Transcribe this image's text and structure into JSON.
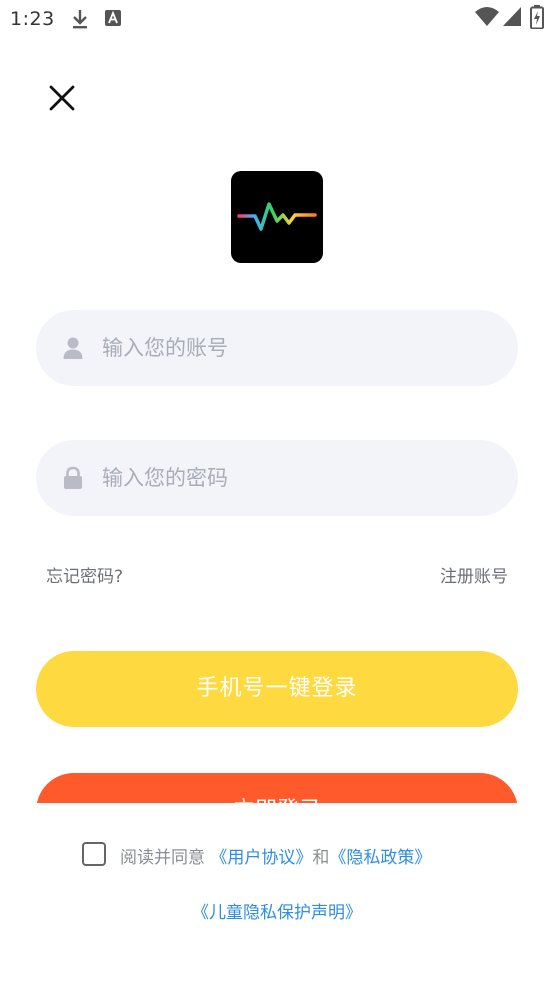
{
  "status_bar": {
    "time": "1:23",
    "icons": [
      "download-icon",
      "text-icon",
      "wifi-icon",
      "signal-icon",
      "battery-charging-icon"
    ]
  },
  "header": {
    "close_icon": "close-icon"
  },
  "logo": {
    "icon": "waveform-icon"
  },
  "form": {
    "account": {
      "placeholder": "输入您的账号",
      "value": "",
      "icon": "user-icon"
    },
    "password": {
      "placeholder": "输入您的密码",
      "value": "",
      "icon": "lock-icon"
    },
    "forgot_label": "忘记密码?",
    "register_label": "注册账号"
  },
  "buttons": {
    "phone_login_label": "手机号一键登录",
    "login_label": "立即登录"
  },
  "agreement": {
    "checked": false,
    "prefix": "阅读并同意 ",
    "user_agreement": "《用户协议》",
    "conjunction": "和",
    "privacy_policy": "《隐私政策》",
    "child_privacy": "《儿童隐私保护声明》"
  },
  "colors": {
    "yellow_button": "#fed93f",
    "orange_button": "#ff5a2c",
    "input_bg": "#f3f4fa",
    "link_blue": "#2e8ee0"
  }
}
